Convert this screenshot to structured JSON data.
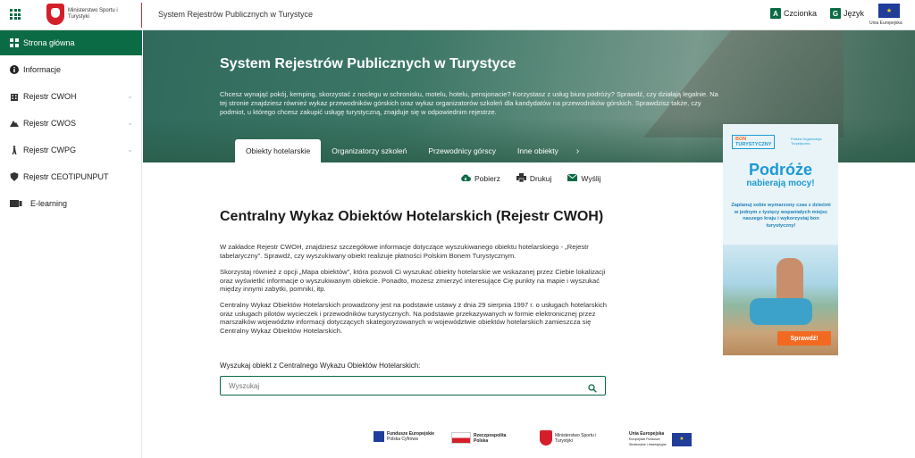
{
  "topbar": {
    "ministry_logo_text": "Ministerstwo Sportu i Turystyki",
    "system_title": "System Rejestrów Publicznych w Turystyce",
    "font_label": "Czcionka",
    "language_label": "Język",
    "eu_label": "Unia Europejska"
  },
  "sidebar": {
    "items": [
      {
        "label": "Strona główna",
        "icon": "dashboard-icon"
      },
      {
        "label": "Informacje",
        "icon": "info-icon"
      },
      {
        "label": "Rejestr CWOH",
        "icon": "building-icon"
      },
      {
        "label": "Rejestr CWOS",
        "icon": "mountain-icon"
      },
      {
        "label": "Rejestr CWPG",
        "icon": "hiker-icon"
      },
      {
        "label": "Rejestr CEOTIPUNPUT",
        "icon": "shield-icon"
      },
      {
        "label": "E-learning",
        "icon": "book-icon"
      }
    ]
  },
  "hero": {
    "title": "System Rejestrów Publicznych w Turystyce",
    "description": "Chcesz wynająć pokój, kemping, skorzystać z noclegu w schronisku, motelu, hotelu, pensjonacie? Korzystasz z usług biura podróży? Sprawdź, czy działają legalnie. Na tej stronie znajdziesz również wykaz przewodników górskich oraz wykaz organizatorów szkoleń dla kandydatów na przewodników górskich. Sprawdzisz także, czy podmiot, u którego chcesz zakupić usługę turystyczną, znajduje się w odpowiednim rejestrze."
  },
  "tabs": [
    {
      "label": "Obiekty hotelarskie"
    },
    {
      "label": "Organizatorzy szkoleń"
    },
    {
      "label": "Przewodnicy górscy"
    },
    {
      "label": "Inne obiekty"
    }
  ],
  "actions": {
    "download": "Pobierz",
    "print": "Drukuj",
    "send": "Wyślij"
  },
  "main": {
    "title": "Centralny Wykaz Obiektów Hotelarskich (Rejestr CWOH)",
    "paragraphs": [
      "W zakładce Rejestr CWOH, znajdziesz szczegółowe informacje dotyczące wyszukiwanego obiektu hotelarskiego - „Rejestr tabelaryczny”. Sprawdź, czy wyszukiwany obiekt realizuje płatności Polskim Bonem Turystycznym.",
      "Skorzystaj również z opcji „Mapa obiektów”, która pozwoli Ci wyszukać obiekty hotelarskie we wskazanej przez Ciebie lokalizacji oraz wyświetlić informacje o wyszukiwanym obiekcie. Ponadto, możesz zmierzyć interesujące Cię punkty na mapie i wyszukać między innymi zabytki, pomniki, itp.",
      "Centralny Wykaz Obiektów Hotelarskich prowadzony jest  na podstawie ustawy z dnia 29 sierpnia 1997 r. o usługach hotelarskich oraz usługach pilotów wycieczek i przewodników turystycznych. Na podstawie przekazywanych w formie elektronicznej przez marszałków województw informacji dotyczących skategoryzowanych w województwie obiektów hotelarskich zamieszcza się Centralny Wykaz Obiektów Hotelarskich."
    ],
    "search_label": "Wyszukaj obiekt z Centralnego Wykazu Obiektów Hotelarskich:",
    "search_placeholder": "Wyszukaj"
  },
  "banner": {
    "logo_top": "BON",
    "logo_bottom": "TURYSTYCZNY",
    "small_logo_text": "Polska Organizacja Turystyczna",
    "headline": "Podróże",
    "subheadline": "nabierają mocy!",
    "text": "Zaplanuj sobie wymarzony czas z dziećmi w jednym z tysięcy wspaniałych miejsc naszego kraju i wykorzystaj bon turystyczny!",
    "button": "Sprawdź!"
  },
  "footer": {
    "fe_text": "Fundusze Europejskie",
    "fe_sub": "Polska Cyfrowa",
    "rp_text": "Rzeczpospolita Polska",
    "msit_text": "Ministerstwo Sportu i Turystyki",
    "ue_text": "Unia Europejska",
    "ue_sub": "Europejskie Fundusze Strukturalne i Inwestycyjne"
  },
  "colors": {
    "accent": "#0b6b45",
    "banner_blue": "#1c9ad6",
    "banner_orange": "#f26a21"
  }
}
